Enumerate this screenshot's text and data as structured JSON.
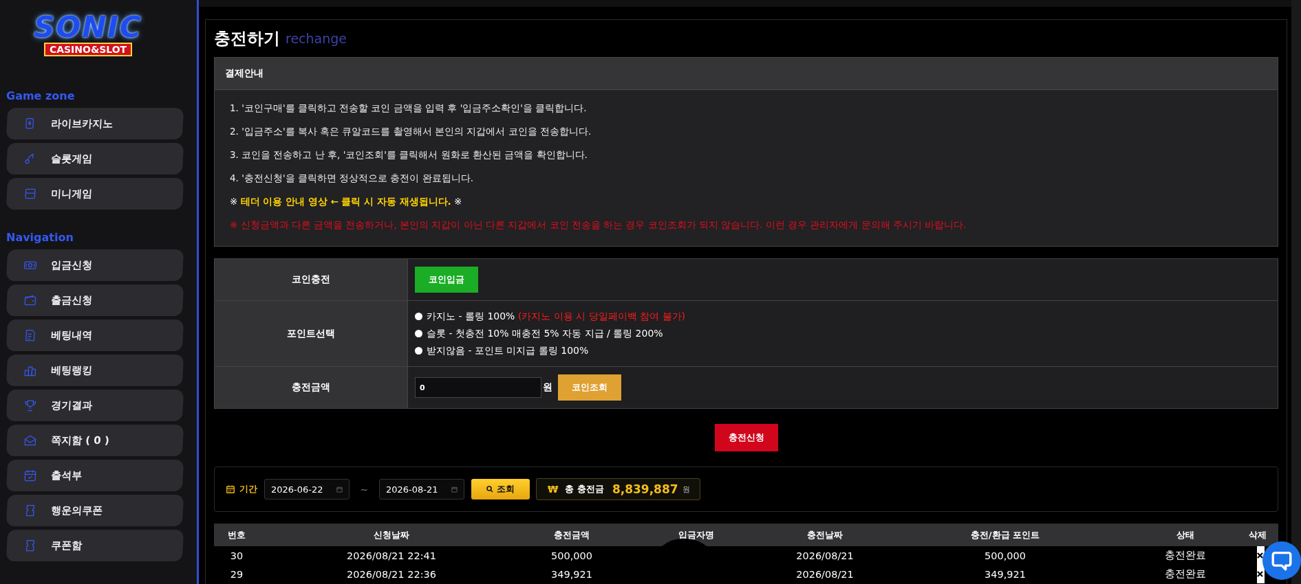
{
  "logo": {
    "title": "SONIC",
    "subtitle": "CASINO&SLOT"
  },
  "sidebar": {
    "sections": [
      {
        "heading": "Game zone",
        "items": [
          {
            "label": "라이브카지노"
          },
          {
            "label": "슬롯게임"
          },
          {
            "label": "미니게임"
          }
        ]
      },
      {
        "heading": "Navigation",
        "items": [
          {
            "label": "입금신청"
          },
          {
            "label": "출금신청"
          },
          {
            "label": "베팅내역"
          },
          {
            "label": "베팅랭킹"
          },
          {
            "label": "경기결과"
          },
          {
            "label": "쪽지함 ( 0 )"
          },
          {
            "label": "출석부"
          },
          {
            "label": "행운의쿠폰"
          },
          {
            "label": "쿠폰함"
          }
        ]
      }
    ]
  },
  "page": {
    "title": "충전하기",
    "subtitle": "rechange"
  },
  "notice": {
    "heading": "결제안내",
    "lines": [
      {
        "kind": "plain",
        "text": "1. '코인구매'를 클릭하고 전송할 코인 금액을 입력 후 '입금주소확인'을 클릭합니다."
      },
      {
        "kind": "plain",
        "text": "2. '입금주소'를 복사 혹은 큐알코드를 촬영해서 본인의 지갑에서 코인을 전송합니다."
      },
      {
        "kind": "plain",
        "text": "3. 코인을 전송하고 난 후, '코인조회'를 클릭해서 원화로 환산된 금액을 확인합니다."
      },
      {
        "kind": "plain",
        "text": "4. '충전신청'을 클릭하면 정상적으로 충전이 완료됩니다."
      },
      {
        "kind": "link",
        "text": "※ **테더 이용 안내 영상 ← 클릭 시 자동 재생됩니다.** ※"
      },
      {
        "kind": "warning",
        "text": "※ 신청금액과 다른 금액을 전송하거나, 본인의 지갑이 아닌 다른 지갑에서 코인 전송을 하는 경우 코인조회가 되지 않습니다. 이런 경우 관리자에게 문의해 주시기 바랍니다."
      }
    ]
  },
  "form": {
    "coin_label": "코인충전",
    "coin_button": "코인입금",
    "point_label": "포인트선택",
    "point_options": [
      {
        "text": "카지노 - 롤링 100%",
        "note": "(카지노 이용 시 당일페이백 참여 불가)",
        "selected": false
      },
      {
        "text": "슬롯 - 첫충전 10% 매충전 5% 자동 지급 / 롤링 200%",
        "selected": false
      },
      {
        "text": "받지않음 - 포인트 미지급 롤링 100%",
        "selected": false
      }
    ],
    "amount_label": "충전금액",
    "amount_value": "0",
    "unit": "원",
    "check_button": "코인조회",
    "submit_button": "충전신청"
  },
  "filter": {
    "label": "기간",
    "from": "2026-06-22",
    "separator": "~",
    "to": "2026-08-21",
    "search_button": "조회",
    "currency_symbol": "₩",
    "total_label": "총 충전금",
    "total_value": "8,839,887",
    "total_unit": "원"
  },
  "table": {
    "columns": [
      "번호",
      "신청날짜",
      "충전금액",
      "입금자명",
      "충전날짜",
      "충전/환급 포인트",
      "상태",
      "삭제"
    ],
    "rows": [
      {
        "number": "30",
        "requested": "2026/08/21 22:41",
        "amount": "500,000",
        "charged": "2026/08/21",
        "points": "500,000",
        "status": "충전완료"
      },
      {
        "number": "29",
        "requested": "2026/08/21 22:36",
        "amount": "349,921",
        "charged": "2026/08/21",
        "points": "349,921",
        "status": "충전완료"
      }
    ]
  }
}
